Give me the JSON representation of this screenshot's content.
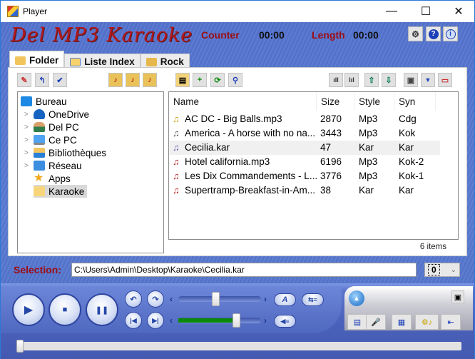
{
  "window": {
    "title": "Player",
    "controls": {
      "minimize": "—",
      "maximize": "☐",
      "close": "✕"
    }
  },
  "header": {
    "logo": "Del MP3 Karaoke",
    "counter_label": "Counter",
    "counter_value": "00:00",
    "length_label": "Length",
    "length_value": "00:00",
    "buttons": [
      {
        "name": "settings",
        "glyph": "⚙"
      },
      {
        "name": "help",
        "glyph": "?"
      },
      {
        "name": "info",
        "glyph": "i"
      }
    ]
  },
  "tabs": [
    {
      "label": "Folder",
      "active": true
    },
    {
      "label": "Liste Index",
      "active": false
    },
    {
      "label": "Rock",
      "active": false
    }
  ],
  "tree_toolbar": [
    {
      "name": "edit",
      "glyph": "✎"
    },
    {
      "name": "up",
      "glyph": "↰"
    },
    {
      "name": "check",
      "glyph": "✔"
    },
    {
      "name": "folder-music-1",
      "glyph": "♪"
    },
    {
      "name": "folder-music-2",
      "glyph": "♪"
    },
    {
      "name": "folder-music-3",
      "glyph": "♪"
    }
  ],
  "tree": [
    {
      "label": "Bureau",
      "level": 0,
      "icon": "desktop-icon",
      "expandable": false
    },
    {
      "label": "OneDrive",
      "level": 1,
      "icon": "cloud-icon",
      "expandable": true
    },
    {
      "label": "Del PC",
      "level": 1,
      "icon": "user-icon",
      "expandable": true
    },
    {
      "label": "Ce PC",
      "level": 1,
      "icon": "computer-icon",
      "expandable": true
    },
    {
      "label": "Bibliothèques",
      "level": 1,
      "icon": "library-icon",
      "expandable": true
    },
    {
      "label": "Réseau",
      "level": 1,
      "icon": "network-icon",
      "expandable": true
    },
    {
      "label": "Apps",
      "level": 1,
      "icon": "star-icon",
      "expandable": false
    },
    {
      "label": "Karaoke",
      "level": 1,
      "icon": "folder-icon",
      "expandable": false,
      "selected": true
    }
  ],
  "list_toolbar_left": [
    {
      "name": "open",
      "glyph": "▤"
    },
    {
      "name": "add",
      "glyph": "+"
    },
    {
      "name": "refresh",
      "glyph": "⟳"
    },
    {
      "name": "find",
      "glyph": "⚲"
    }
  ],
  "list_toolbar_right": [
    {
      "name": "equalizer-1",
      "glyph": "ıll"
    },
    {
      "name": "equalizer-2",
      "glyph": "lıl"
    },
    {
      "name": "move-up",
      "glyph": "⇧"
    },
    {
      "name": "move-down",
      "glyph": "⇩"
    },
    {
      "name": "window",
      "glyph": "▣"
    },
    {
      "name": "dropdown",
      "glyph": "▼"
    },
    {
      "name": "panel",
      "glyph": "▭"
    }
  ],
  "list": {
    "columns": [
      "Name",
      "Size",
      "Style",
      "Syn"
    ],
    "rows": [
      {
        "name": "AC DC - Big Balls.mp3",
        "size": "2870",
        "style": "Mp3",
        "syn": "Cdg",
        "note_color": "#c9a000"
      },
      {
        "name": "America - A horse with no na...",
        "size": "3443",
        "style": "Mp3",
        "syn": "Kok",
        "note_color": "#555555"
      },
      {
        "name": "Cecilia.kar",
        "size": "47",
        "style": "Kar",
        "syn": "Kar",
        "note_color": "#6a5fb0",
        "highlight": true
      },
      {
        "name": "Hotel california.mp3",
        "size": "6196",
        "style": "Mp3",
        "syn": "Kok-2",
        "note_color": "#b0202a"
      },
      {
        "name": "Les Dix Commandements - L...",
        "size": "3776",
        "style": "Mp3",
        "syn": "Kok-1",
        "note_color": "#b0202a"
      },
      {
        "name": "Supertramp-Breakfast-in-Am...",
        "size": "38",
        "style": "Kar",
        "syn": "Kar",
        "note_color": "#c01818"
      }
    ],
    "count": "6 items"
  },
  "selection": {
    "label": "Selection:",
    "path": "C:\\Users\\Admin\\Desktop\\Karaoke\\Cecilia.kar",
    "combo_value": "0"
  },
  "player": {
    "buttons": {
      "play": "▶",
      "stop": "■",
      "pause": "❚❚",
      "back": "↶",
      "forward": "↷",
      "prev": "|◀",
      "next": "▶|",
      "text": "A",
      "lyrics": "⇆≡",
      "voice": "◀≡"
    },
    "tempo_fraction": 0.45,
    "volume_fraction": 0.72,
    "seek_fraction": 0.0,
    "right_buttons": [
      {
        "name": "document",
        "glyph": "▤"
      },
      {
        "name": "microphone",
        "glyph": "🎤"
      },
      {
        "name": "video",
        "glyph": "▦"
      },
      {
        "name": "settings-music",
        "glyph": "⚙♪"
      },
      {
        "name": "exit",
        "glyph": "⇤"
      }
    ],
    "eject": "▲",
    "restore": "▣"
  }
}
